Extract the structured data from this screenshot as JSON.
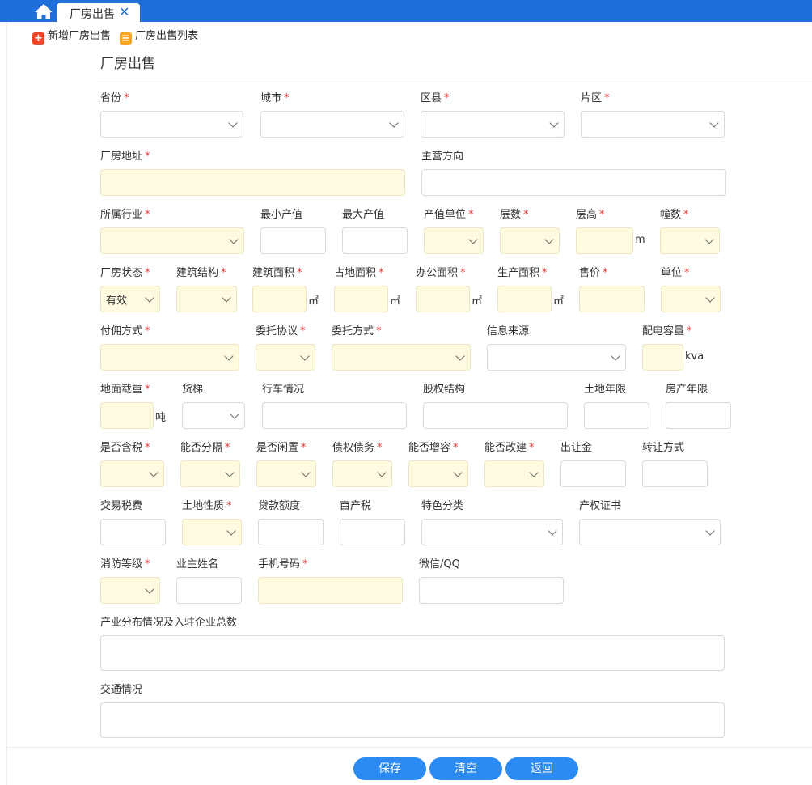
{
  "tab": {
    "label": "厂房出售",
    "close": "✕"
  },
  "toolbar": {
    "add_label": "新增厂房出售",
    "add_icon": "+",
    "list_label": "厂房出售列表",
    "list_icon": "≡"
  },
  "page_title": "厂房出售",
  "fields": {
    "province": {
      "label": "省份",
      "required": true
    },
    "city": {
      "label": "城市",
      "required": true
    },
    "district": {
      "label": "区县",
      "required": true
    },
    "area": {
      "label": "片区",
      "required": true
    },
    "address": {
      "label": "厂房地址",
      "required": true
    },
    "main_direction": {
      "label": "主营方向"
    },
    "industry": {
      "label": "所属行业",
      "required": true
    },
    "min_output": {
      "label": "最小产值"
    },
    "max_output": {
      "label": "最大产值"
    },
    "output_unit": {
      "label": "产值单位",
      "required": true
    },
    "floors": {
      "label": "层数",
      "required": true
    },
    "floor_height": {
      "label": "层高",
      "required": true,
      "unit": "m"
    },
    "buildings": {
      "label": "幢数",
      "required": true
    },
    "status": {
      "label": "厂房状态",
      "required": true,
      "value": "有效"
    },
    "structure": {
      "label": "建筑结构",
      "required": true
    },
    "building_area": {
      "label": "建筑面积",
      "required": true,
      "unit": "㎡"
    },
    "land_area": {
      "label": "占地面积",
      "required": true,
      "unit": "㎡"
    },
    "office_area": {
      "label": "办公面积",
      "required": true,
      "unit": "㎡"
    },
    "production_area": {
      "label": "生产面积",
      "required": true,
      "unit": "㎡"
    },
    "price": {
      "label": "售价",
      "required": true
    },
    "price_unit": {
      "label": "单位",
      "required": true
    },
    "commission": {
      "label": "付佣方式",
      "required": true
    },
    "agreement": {
      "label": "委托协议",
      "required": true
    },
    "entrust_mode": {
      "label": "委托方式",
      "required": true
    },
    "info_source": {
      "label": "信息来源"
    },
    "power_capacity": {
      "label": "配电容量",
      "required": true,
      "unit": "kva"
    },
    "floor_load": {
      "label": "地面载重",
      "required": true,
      "unit": "吨"
    },
    "elevator": {
      "label": "货梯"
    },
    "crane": {
      "label": "行车情况"
    },
    "equity": {
      "label": "股权结构"
    },
    "land_years": {
      "label": "土地年限"
    },
    "property_years": {
      "label": "房产年限"
    },
    "tax_included": {
      "label": "是否含税",
      "required": true
    },
    "separable": {
      "label": "能否分隔",
      "required": true
    },
    "idle": {
      "label": "是否闲置",
      "required": true
    },
    "debt": {
      "label": "债权债务",
      "required": true
    },
    "capacity_increase": {
      "label": "能否增容",
      "required": true
    },
    "renovation": {
      "label": "能否改建",
      "required": true
    },
    "land_grant_fee": {
      "label": "出让金"
    },
    "transfer_mode": {
      "label": "转让方式"
    },
    "transaction_tax": {
      "label": "交易税费"
    },
    "land_nature": {
      "label": "土地性质",
      "required": true
    },
    "loan_amount": {
      "label": "贷款额度"
    },
    "mu_tax": {
      "label": "亩产税"
    },
    "feature_category": {
      "label": "特色分类"
    },
    "property_cert": {
      "label": "产权证书"
    },
    "fire_level": {
      "label": "消防等级",
      "required": true
    },
    "owner_name": {
      "label": "业主姓名"
    },
    "phone": {
      "label": "手机号码",
      "required": true
    },
    "wechat_qq": {
      "label": "微信/QQ"
    },
    "industry_distribution": {
      "label": "产业分布情况及入驻企业总数"
    },
    "traffic": {
      "label": "交通情况"
    }
  },
  "required_mark": "*",
  "buttons": {
    "save": "保存",
    "clear": "清空",
    "back": "返回"
  },
  "colors": {
    "topbar": "#1e6fd9",
    "button": "#2b8bf2",
    "required": "#e53935",
    "required_field_bg": "#fffbe0",
    "add_icon": "#f0452b",
    "list_icon": "#f5a623"
  }
}
